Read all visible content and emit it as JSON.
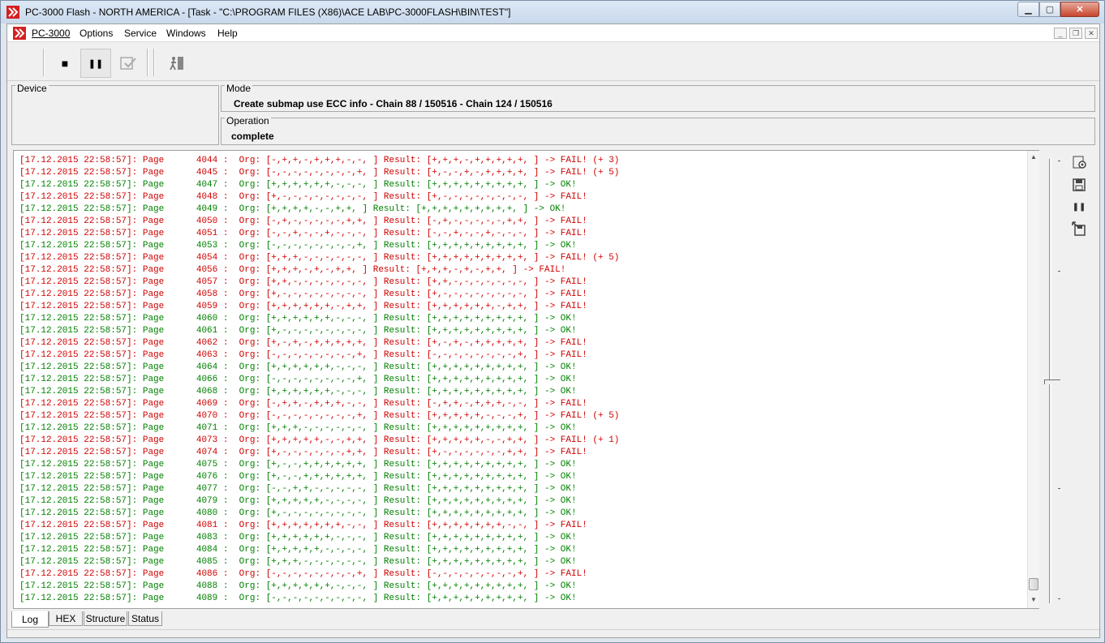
{
  "window": {
    "title": "PC-3000 Flash  - NORTH AMERICA - [Task - \"C:\\PROGRAM FILES (X86)\\ACE LAB\\PC-3000FLASH\\BIN\\TEST\"]",
    "min_glyph": "▁",
    "max_glyph": "▢",
    "close_glyph": "✕"
  },
  "menu": {
    "items": [
      "PC-3000",
      "Options",
      "Service",
      "Windows",
      "Help"
    ],
    "mdi_min": "_",
    "mdi_restore": "❐",
    "mdi_close": "✕"
  },
  "toolbar": {
    "stop_glyph": "■",
    "pause_glyph": "❚❚",
    "icons": [
      "stop-icon",
      "pause-icon",
      "check-icon",
      "exit-icon"
    ]
  },
  "device": {
    "legend": "Device",
    "value": ""
  },
  "mode": {
    "legend": "Mode",
    "value": "Create submap use ECC info - Chain 88 / 150516 - Chain 124 / 150516"
  },
  "operation": {
    "legend": "Operation",
    "value": "complete"
  },
  "log": {
    "lines": [
      {
        "ts": "[17.12.2015 22:58:57]:",
        "page": "4044",
        "org": "[-,+,+,-,+,+,+,-,-, ]",
        "result": "[+,+,+,-,+,+,+,+,+, ]",
        "status": "-> FAIL! (+ 3)",
        "ok": false
      },
      {
        "ts": "[17.12.2015 22:58:57]:",
        "page": "4045",
        "org": "[-,-,-,-,-,-,-,-,+, ]",
        "result": "[+,-,-,+,-,+,+,+,+, ]",
        "status": "-> FAIL! (+ 5)",
        "ok": false
      },
      {
        "ts": "[17.12.2015 22:58:57]:",
        "page": "4047",
        "org": "[+,+,+,+,+,+,-,-,-, ]",
        "result": "[+,+,+,+,+,+,+,+,+, ]",
        "status": "-> OK!",
        "ok": true
      },
      {
        "ts": "[17.12.2015 22:58:57]:",
        "page": "4048",
        "org": "[+,-,-,-,-,-,-,-,-, ]",
        "result": "[+,-,-,-,-,-,-,-,-, ]",
        "status": "-> FAIL!",
        "ok": false
      },
      {
        "ts": "[17.12.2015 22:58:57]:",
        "page": "4049",
        "org": "[+,+,+,+,-,-,+,+, ]",
        "result": "[+,+,+,+,+,+,+,+,+, ]",
        "status": "-> OK!",
        "ok": true
      },
      {
        "ts": "[17.12.2015 22:58:57]:",
        "page": "4050",
        "org": "[-,+,-,-,-,-,-,+,+, ]",
        "result": "[-,+,-,-,-,-,-,+,+, ]",
        "status": "-> FAIL!",
        "ok": false
      },
      {
        "ts": "[17.12.2015 22:58:57]:",
        "page": "4051",
        "org": "[-,-,+,-,-,+,-,-,-, ]",
        "result": "[-,-,+,-,-,+,-,-,-, ]",
        "status": "-> FAIL!",
        "ok": false
      },
      {
        "ts": "[17.12.2015 22:58:57]:",
        "page": "4053",
        "org": "[-,-,-,-,-,-,-,-,+, ]",
        "result": "[+,+,+,+,+,+,+,+,+, ]",
        "status": "-> OK!",
        "ok": true
      },
      {
        "ts": "[17.12.2015 22:58:57]:",
        "page": "4054",
        "org": "[+,+,+,-,-,-,-,-,-, ]",
        "result": "[+,+,+,+,+,+,+,+,+, ]",
        "status": "-> FAIL! (+ 5)",
        "ok": false
      },
      {
        "ts": "[17.12.2015 22:58:57]:",
        "page": "4056",
        "org": "[+,+,+,-,+,-,+,+, ]",
        "result": "[+,+,+,-,+,-,+,+, ]",
        "status": "-> FAIL!",
        "ok": false
      },
      {
        "ts": "[17.12.2015 22:58:57]:",
        "page": "4057",
        "org": "[+,+,-,-,-,-,-,-,-, ]",
        "result": "[+,+,-,-,-,-,-,-,-, ]",
        "status": "-> FAIL!",
        "ok": false
      },
      {
        "ts": "[17.12.2015 22:58:57]:",
        "page": "4058",
        "org": "[+,-,-,-,-,-,-,-,-, ]",
        "result": "[+,-,-,-,-,-,-,-,-, ]",
        "status": "-> FAIL!",
        "ok": false
      },
      {
        "ts": "[17.12.2015 22:58:57]:",
        "page": "4059",
        "org": "[+,+,+,+,+,+,-,+,+, ]",
        "result": "[+,+,+,+,+,+,-,+,+, ]",
        "status": "-> FAIL!",
        "ok": false
      },
      {
        "ts": "[17.12.2015 22:58:57]:",
        "page": "4060",
        "org": "[+,+,+,+,+,+,-,-,-, ]",
        "result": "[+,+,+,+,+,+,+,+,+, ]",
        "status": "-> OK!",
        "ok": true
      },
      {
        "ts": "[17.12.2015 22:58:57]:",
        "page": "4061",
        "org": "[+,-,-,-,-,-,-,-,-, ]",
        "result": "[+,+,+,+,+,+,+,+,+, ]",
        "status": "-> OK!",
        "ok": true
      },
      {
        "ts": "[17.12.2015 22:58:57]:",
        "page": "4062",
        "org": "[+,-,+,-,+,+,+,+,+, ]",
        "result": "[+,-,+,-,+,+,+,+,+, ]",
        "status": "-> FAIL!",
        "ok": false
      },
      {
        "ts": "[17.12.2015 22:58:57]:",
        "page": "4063",
        "org": "[-,-,-,-,-,-,-,-,+, ]",
        "result": "[-,-,-,-,-,-,-,-,+, ]",
        "status": "-> FAIL!",
        "ok": false
      },
      {
        "ts": "[17.12.2015 22:58:57]:",
        "page": "4064",
        "org": "[+,+,+,+,+,+,-,-,-, ]",
        "result": "[+,+,+,+,+,+,+,+,+, ]",
        "status": "-> OK!",
        "ok": true
      },
      {
        "ts": "[17.12.2015 22:58:57]:",
        "page": "4066",
        "org": "[-,-,-,-,-,-,-,-,+, ]",
        "result": "[+,+,+,+,+,+,+,+,+, ]",
        "status": "-> OK!",
        "ok": true
      },
      {
        "ts": "[17.12.2015 22:58:57]:",
        "page": "4068",
        "org": "[+,+,+,+,+,+,-,-,-, ]",
        "result": "[+,+,+,+,+,+,+,+,+, ]",
        "status": "-> OK!",
        "ok": true
      },
      {
        "ts": "[17.12.2015 22:58:57]:",
        "page": "4069",
        "org": "[-,+,+,-,+,+,+,-,-, ]",
        "result": "[-,+,+,-,+,+,+,-,-, ]",
        "status": "-> FAIL!",
        "ok": false
      },
      {
        "ts": "[17.12.2015 22:58:57]:",
        "page": "4070",
        "org": "[-,-,-,-,-,-,-,-,+, ]",
        "result": "[+,+,+,+,+,-,-,-,+, ]",
        "status": "-> FAIL! (+ 5)",
        "ok": false
      },
      {
        "ts": "[17.12.2015 22:58:57]:",
        "page": "4071",
        "org": "[+,+,+,-,-,-,-,-,-, ]",
        "result": "[+,+,+,+,+,+,+,+,+, ]",
        "status": "-> OK!",
        "ok": true
      },
      {
        "ts": "[17.12.2015 22:58:57]:",
        "page": "4073",
        "org": "[+,+,+,+,+,-,-,+,+, ]",
        "result": "[+,+,+,+,+,-,-,+,+, ]",
        "status": "-> FAIL! (+ 1)",
        "ok": false
      },
      {
        "ts": "[17.12.2015 22:58:57]:",
        "page": "4074",
        "org": "[+,-,-,-,-,-,-,+,+, ]",
        "result": "[+,-,-,-,-,-,-,+,+, ]",
        "status": "-> FAIL!",
        "ok": false
      },
      {
        "ts": "[17.12.2015 22:58:57]:",
        "page": "4075",
        "org": "[+,-,-,+,+,+,+,+,+, ]",
        "result": "[+,+,+,+,+,+,+,+,+, ]",
        "status": "-> OK!",
        "ok": true
      },
      {
        "ts": "[17.12.2015 22:58:57]:",
        "page": "4076",
        "org": "[+,-,-,+,+,+,+,+,+, ]",
        "result": "[+,+,+,+,+,+,+,+,+, ]",
        "status": "-> OK!",
        "ok": true
      },
      {
        "ts": "[17.12.2015 22:58:57]:",
        "page": "4077",
        "org": "[-,-,+,+,-,-,-,-,-, ]",
        "result": "[+,+,+,+,+,+,+,+,+, ]",
        "status": "-> OK!",
        "ok": true
      },
      {
        "ts": "[17.12.2015 22:58:57]:",
        "page": "4079",
        "org": "[+,+,+,+,+,-,-,-,-, ]",
        "result": "[+,+,+,+,+,+,+,+,+, ]",
        "status": "-> OK!",
        "ok": true
      },
      {
        "ts": "[17.12.2015 22:58:57]:",
        "page": "4080",
        "org": "[+,-,-,-,-,-,-,-,-, ]",
        "result": "[+,+,+,+,+,+,+,+,+, ]",
        "status": "-> OK!",
        "ok": true
      },
      {
        "ts": "[17.12.2015 22:58:57]:",
        "page": "4081",
        "org": "[+,+,+,+,+,+,+,-,-, ]",
        "result": "[+,+,+,+,+,+,+,-,-, ]",
        "status": "-> FAIL!",
        "ok": false
      },
      {
        "ts": "[17.12.2015 22:58:57]:",
        "page": "4083",
        "org": "[+,+,+,+,+,+,-,-,-, ]",
        "result": "[+,+,+,+,+,+,+,+,+, ]",
        "status": "-> OK!",
        "ok": true
      },
      {
        "ts": "[17.12.2015 22:58:57]:",
        "page": "4084",
        "org": "[+,+,+,+,+,-,-,-,-, ]",
        "result": "[+,+,+,+,+,+,+,+,+, ]",
        "status": "-> OK!",
        "ok": true
      },
      {
        "ts": "[17.12.2015 22:58:57]:",
        "page": "4085",
        "org": "[+,+,+,-,-,-,-,-,-, ]",
        "result": "[+,+,+,+,+,+,+,+,+, ]",
        "status": "-> OK!",
        "ok": true
      },
      {
        "ts": "[17.12.2015 22:58:57]:",
        "page": "4086",
        "org": "[-,-,-,-,-,-,-,-,+, ]",
        "result": "[-,-,-,-,-,-,-,-,+, ]",
        "status": "-> FAIL!",
        "ok": false
      },
      {
        "ts": "[17.12.2015 22:58:57]:",
        "page": "4088",
        "org": "[+,+,+,+,+,+,-,-,-, ]",
        "result": "[+,+,+,+,+,+,+,+,+, ]",
        "status": "-> OK!",
        "ok": true
      },
      {
        "ts": "[17.12.2015 22:58:57]:",
        "page": "4089",
        "org": "[-,-,-,-,-,-,-,-,-, ]",
        "result": "[+,+,+,+,+,+,+,+,+, ]",
        "status": "-> OK!",
        "ok": true
      }
    ],
    "page_label": "Page",
    "org_label": "Org:",
    "result_label": "Result:",
    "colors": {
      "fail": "#d00000",
      "ok": "#008000"
    }
  },
  "tabs": [
    {
      "label": "Log",
      "active": true
    },
    {
      "label": "HEX",
      "active": false
    },
    {
      "label": "Structure",
      "active": false
    },
    {
      "label": "Status",
      "active": false
    }
  ],
  "sidetools": {
    "icons": [
      "settings-icon",
      "save-icon",
      "pause-icon",
      "export-icon"
    ],
    "pause_glyph": "❚❚"
  }
}
